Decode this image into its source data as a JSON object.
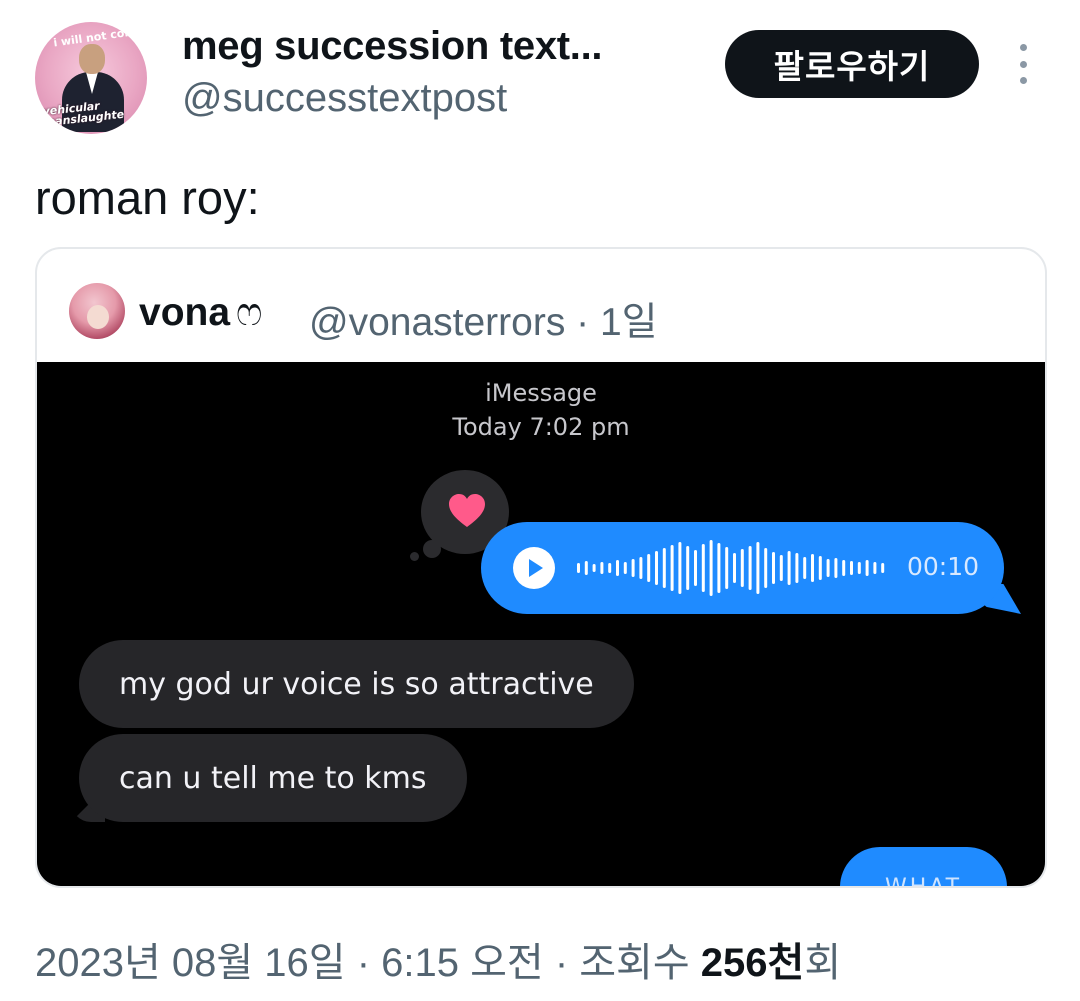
{
  "author": {
    "display_name": "meg succession text...",
    "handle": "@successtextpost",
    "avatar_caption_top": "i will not comm",
    "avatar_caption_bottom_line1": "vehicular",
    "avatar_caption_bottom_line2": "manslaughte"
  },
  "follow_label": "팔로우하기",
  "tweet_text": "roman roy:",
  "quoted": {
    "display_name": "vona",
    "name_decoration": "ෆ",
    "handle_and_time": "@vonasterrors · 1일",
    "screenshot": {
      "service": "iMessage",
      "timestamp": "Today 7:02 pm",
      "voice_duration": "00:10",
      "received": [
        "my god ur voice is so attractive",
        "can u tell me to kms"
      ],
      "sent_partial": "WHAT"
    }
  },
  "footer": {
    "date_time": "2023년 08월 16일 · 6:15 오전 · 조회수 ",
    "views_number": "256천",
    "views_suffix": "회"
  },
  "colors": {
    "follow_bg": "#0f1419",
    "secondary_text": "#536471",
    "imessage_blue": "#1f8bff",
    "imessage_received": "#262629",
    "heart": "#ff5a8a"
  }
}
